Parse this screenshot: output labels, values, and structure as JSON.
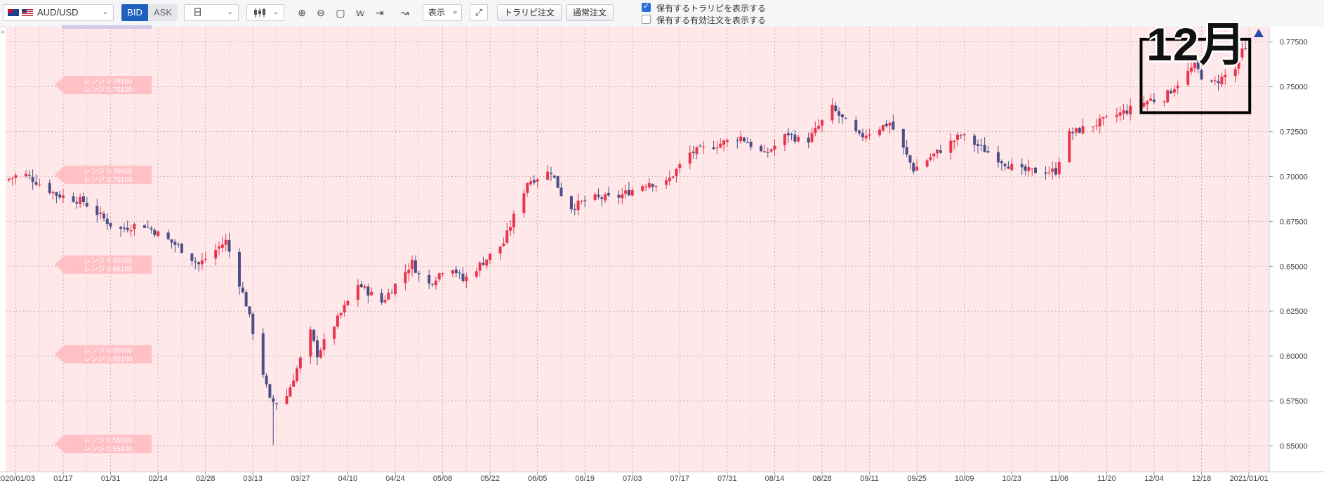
{
  "toolbar": {
    "pair_label": "AUD/USD",
    "bid_label": "BID",
    "ask_label": "ASK",
    "timeframe": "日",
    "chart_type_icon": "candlestick-icon",
    "display_label": "表示",
    "trail_order_label": "トラリピ注文",
    "normal_order_label": "通常注文",
    "check_show_trail": "保有するトラリピを表示する",
    "check_show_orders": "保有する有効注文を表示する"
  },
  "colors": {
    "bull": "#e8364c",
    "bear": "#4a4f86",
    "background": "#ffe8ea",
    "range_tag": "#ffb8c0",
    "accent": "#1f5fbf"
  },
  "annotation": {
    "title": "12月"
  },
  "chart_data": {
    "type": "candlestick",
    "symbol": "AUD/USD",
    "x_axis": {
      "range": [
        "2019-12-31",
        "2021-01-07"
      ],
      "ticks": [
        "2020/01/03",
        "01/17",
        "01/31",
        "02/14",
        "02/28",
        "03/13",
        "03/27",
        "04/10",
        "04/24",
        "05/08",
        "05/22",
        "06/05",
        "06/19",
        "07/03",
        "07/17",
        "07/31",
        "08/14",
        "08/28",
        "09/11",
        "09/25",
        "10/09",
        "10/23",
        "11/06",
        "11/20",
        "12/04",
        "12/18",
        "2021/01/01"
      ]
    },
    "y_axis": {
      "min": 0.5355,
      "max": 0.7835,
      "ticks": [
        "0.55000",
        "0.57500",
        "0.60000",
        "0.62500",
        "0.65000",
        "0.67500",
        "0.70000",
        "0.72500",
        "0.75000",
        "0.77500"
      ]
    },
    "grid": true,
    "range_tags": [
      {
        "line1": "レンジ 0.78100",
        "line2": "レンジ 0.75100",
        "value": 0.751
      },
      {
        "line1": "レンジ 0.70600",
        "line2": "レンジ 0.70100",
        "value": 0.701
      },
      {
        "line1": "レンジ 0.65600",
        "line2": "レンジ 0.65100",
        "value": 0.651
      },
      {
        "line1": "レンジ 0.60600",
        "line2": "レンジ 0.60100",
        "value": 0.601
      },
      {
        "line1": "レンジ 0.55600",
        "line2": "レンジ 0.55100",
        "value": 0.551
      }
    ],
    "highlight": {
      "start": "2020-12-01",
      "end": "2020-12-31",
      "label": "12月"
    },
    "key_points": [
      [
        "2020-01-01",
        0.698
      ],
      [
        "2020-01-06",
        0.702
      ],
      [
        "2020-01-16",
        0.69
      ],
      [
        "2020-01-24",
        0.686
      ],
      [
        "2020-02-03",
        0.67
      ],
      [
        "2020-02-10",
        0.674
      ],
      [
        "2020-02-21",
        0.661
      ],
      [
        "2020-02-27",
        0.651
      ],
      [
        "2020-03-06",
        0.664
      ],
      [
        "2020-03-12",
        0.629
      ],
      [
        "2020-03-19",
        0.575
      ],
      [
        "2020-03-23",
        0.573
      ],
      [
        "2020-03-31",
        0.613
      ],
      [
        "2020-04-02",
        0.601
      ],
      [
        "2020-04-14",
        0.64
      ],
      [
        "2020-04-21",
        0.63
      ],
      [
        "2020-04-30",
        0.652
      ],
      [
        "2020-05-04",
        0.638
      ],
      [
        "2020-05-11",
        0.652
      ],
      [
        "2020-05-15",
        0.642
      ],
      [
        "2020-05-27",
        0.663
      ],
      [
        "2020-06-03",
        0.697
      ],
      [
        "2020-06-10",
        0.703
      ],
      [
        "2020-06-15",
        0.682
      ],
      [
        "2020-06-22",
        0.688
      ],
      [
        "2020-06-29",
        0.688
      ],
      [
        "2020-07-09",
        0.697
      ],
      [
        "2020-07-13",
        0.694
      ],
      [
        "2020-07-21",
        0.713
      ],
      [
        "2020-08-05",
        0.722
      ],
      [
        "2020-08-12",
        0.712
      ],
      [
        "2020-08-19",
        0.724
      ],
      [
        "2020-08-24",
        0.718
      ],
      [
        "2020-09-01",
        0.738
      ],
      [
        "2020-09-09",
        0.722
      ],
      [
        "2020-09-18",
        0.73
      ],
      [
        "2020-09-25",
        0.704
      ],
      [
        "2020-10-09",
        0.723
      ],
      [
        "2020-10-26",
        0.703
      ],
      [
        "2020-11-06",
        0.703
      ],
      [
        "2020-11-09",
        0.723
      ],
      [
        "2020-11-20",
        0.731
      ],
      [
        "2020-12-01",
        0.74
      ],
      [
        "2020-12-04",
        0.743
      ],
      [
        "2020-12-07",
        0.742
      ],
      [
        "2020-12-17",
        0.762
      ],
      [
        "2020-12-21",
        0.75
      ],
      [
        "2020-12-29",
        0.76
      ],
      [
        "2020-12-31",
        0.77
      ]
    ]
  }
}
